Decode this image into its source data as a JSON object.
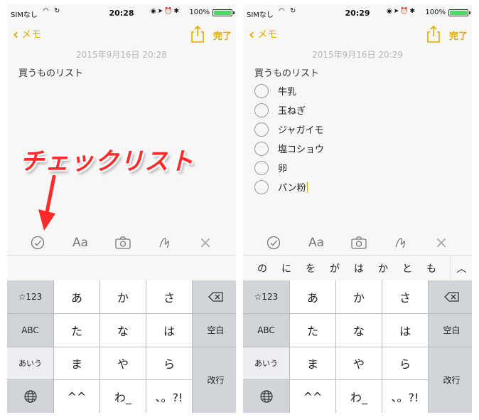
{
  "left": {
    "status": {
      "carrier": "SIMなし",
      "time": "20:28",
      "battery": "100%"
    },
    "nav": {
      "back_label": "メモ",
      "done_label": "完了"
    },
    "note": {
      "date": "2015年9月16日 20:28",
      "title": "買うものリスト"
    },
    "annotation": {
      "label": "チェックリスト"
    }
  },
  "right": {
    "status": {
      "carrier": "SIMなし",
      "time": "20:29",
      "battery": "100%"
    },
    "nav": {
      "back_label": "メモ",
      "done_label": "完了"
    },
    "note": {
      "date": "2015年9月16日 20:29",
      "title": "買うものリスト"
    },
    "checklist": [
      {
        "label": "牛乳"
      },
      {
        "label": "玉ねぎ"
      },
      {
        "label": "ジャガイモ"
      },
      {
        "label": "塩コショウ"
      },
      {
        "label": "卵"
      },
      {
        "label": "パン粉"
      }
    ],
    "suggestions": [
      "の",
      "に",
      "を",
      "が",
      "は",
      "か",
      "と",
      "も"
    ]
  },
  "toolbar": {
    "format_label": "Aa"
  },
  "keyboard": {
    "num": "☆123",
    "a": "あ",
    "ka": "か",
    "sa": "さ",
    "abc": "ABC",
    "ta": "た",
    "na": "な",
    "ha": "は",
    "space": "空白",
    "kana": "あいう",
    "ma": "ま",
    "ya": "や",
    "ra": "ら",
    "enter": "改行",
    "kaomoji": "^^",
    "wa": "わ_",
    "punct": "、。?!"
  },
  "colors": {
    "accent": "#e4a800",
    "annotation": "#ff2a2a",
    "battery": "#4cd964"
  }
}
